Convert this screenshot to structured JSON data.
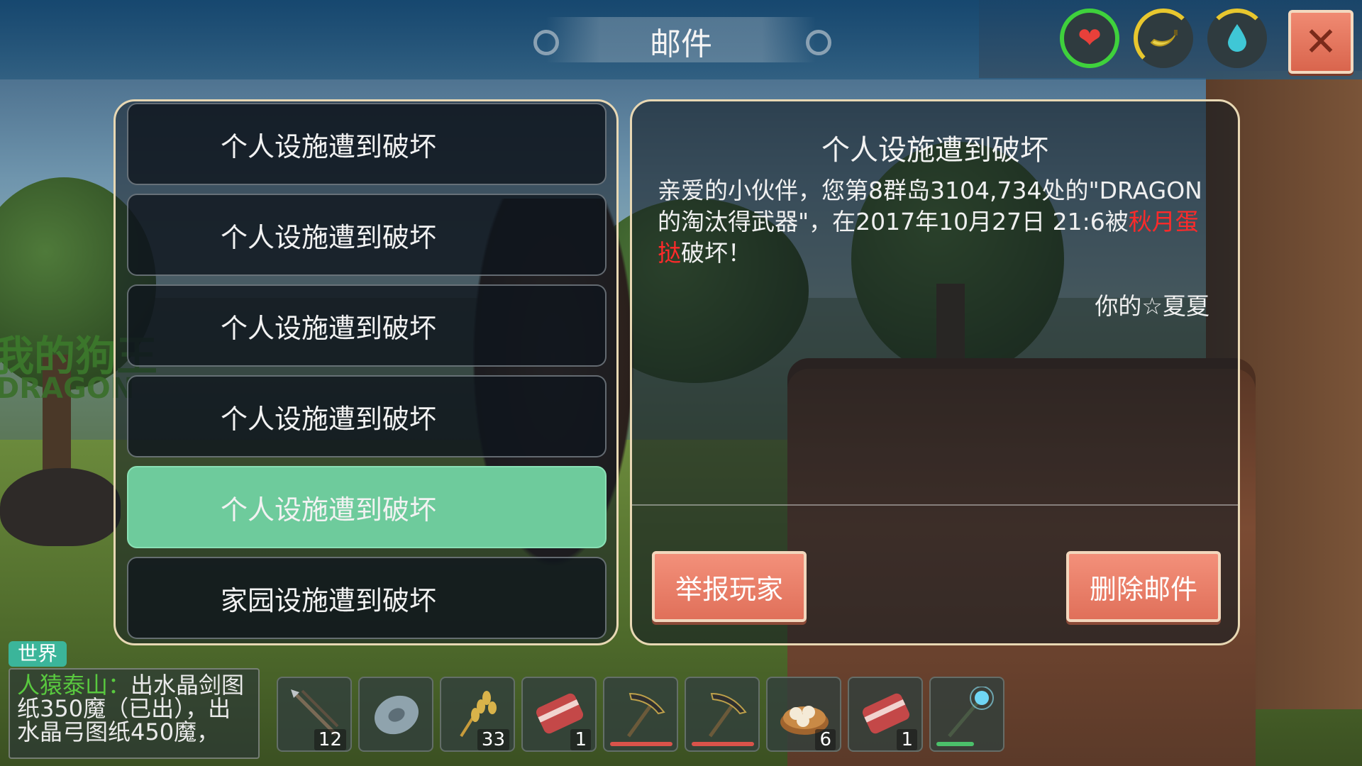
{
  "window": {
    "title": "邮件",
    "close_label": "✕"
  },
  "stats": [
    {
      "icon": "heart-icon",
      "glyph": "❤",
      "color": "#e8403a"
    },
    {
      "icon": "banana-icon",
      "glyph": "🍌",
      "color": "#e8c72e"
    },
    {
      "icon": "water-drop-icon",
      "glyph": "💧",
      "color": "#3fc7d6"
    }
  ],
  "background": {
    "name_tag": "我的狗王",
    "name_tag_sub": "DRAGON"
  },
  "mail_list": {
    "items": [
      {
        "label": "个人设施遭到破坏",
        "selected": false
      },
      {
        "label": "个人设施遭到破坏",
        "selected": false
      },
      {
        "label": "个人设施遭到破坏",
        "selected": false
      },
      {
        "label": "个人设施遭到破坏",
        "selected": false
      },
      {
        "label": "个人设施遭到破坏",
        "selected": true
      },
      {
        "label": "家园设施遭到破坏",
        "selected": false
      }
    ]
  },
  "mail_detail": {
    "title": "个人设施遭到破坏",
    "body_part1": "亲爱的小伙伴，您第8群岛3104,734处的\"DRAGON的淘汰得武器\"，在2017年10月27日 21:6被",
    "body_attacker": "秋月蛋挞",
    "body_part2": "破坏！",
    "signature": "你的☆夏夏",
    "report_button": "举报玩家",
    "delete_button": "删除邮件"
  },
  "chat": {
    "tab_label": "世界",
    "sender": "人猿泰山：",
    "message": "出水晶剑图纸350魔（已出），出水晶弓图纸450魔，"
  },
  "hotbar": [
    {
      "item": "spear-icon",
      "count": "12",
      "durability": null
    },
    {
      "item": "stone-disc-icon",
      "count": "",
      "durability": null
    },
    {
      "item": "wheat-icon",
      "count": "33",
      "durability": null
    },
    {
      "item": "raw-meat-icon",
      "count": "1",
      "durability": null
    },
    {
      "item": "pickaxe-icon",
      "count": "",
      "durability": 1.0,
      "durability_color": "#d9534a"
    },
    {
      "item": "pickaxe-icon",
      "count": "",
      "durability": 1.0,
      "durability_color": "#d9534a"
    },
    {
      "item": "steamed-buns-icon",
      "count": "6",
      "durability": null
    },
    {
      "item": "raw-meat-icon",
      "count": "1",
      "durability": null
    },
    {
      "item": "crystal-staff-icon",
      "count": "",
      "durability": 0.6,
      "durability_color": "#4bc06a"
    }
  ]
}
